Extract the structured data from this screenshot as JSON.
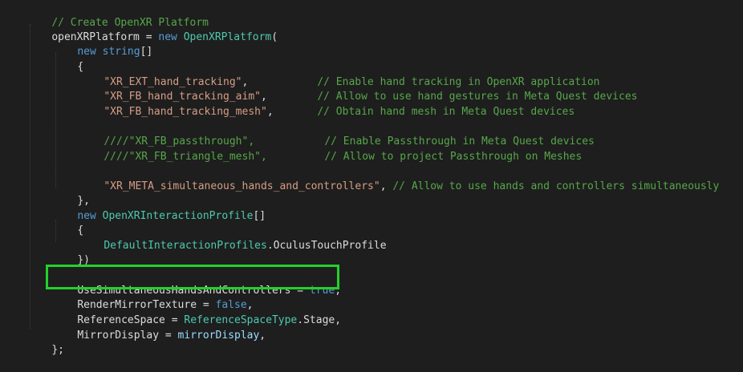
{
  "highlight_color": "#22d12a",
  "editor_background": "#1e1e1e",
  "lines": {
    "l1": {
      "comment": "// Create OpenXR Platform"
    },
    "l2": {
      "var": "openXRPlatform",
      "eq": " = ",
      "kw": "new",
      "type": "OpenXRPlatform",
      "paren": "("
    },
    "l3": {
      "kw": "new",
      "kw2": "string",
      "br": "[]"
    },
    "l4": {
      "brace": "{"
    },
    "l5": {
      "str": "\"XR_EXT_hand_tracking\"",
      "sep": ",",
      "comment": "// Enable hand tracking in OpenXR application"
    },
    "l6": {
      "str": "\"XR_FB_hand_tracking_aim\"",
      "sep": ",",
      "comment": "// Allow to use hand gestures in Meta Quest devices"
    },
    "l7": {
      "str": "\"XR_FB_hand_tracking_mesh\"",
      "sep": ",",
      "comment": "// Obtain hand mesh in Meta Quest devices"
    },
    "l8": {
      "comment": "////\"XR_FB_passthrough\",",
      "comment2": "// Enable Passthrough in Meta Quest devices"
    },
    "l9": {
      "comment": "////\"XR_FB_triangle_mesh\",",
      "comment2": "// Allow to project Passthrough on Meshes"
    },
    "l10": {
      "str": "\"XR_META_simultaneous_hands_and_controllers\"",
      "sep": ", ",
      "comment": "// Allow to use hands and controllers simultaneously"
    },
    "l11": {
      "text": "},"
    },
    "l12": {
      "kw": "new",
      "type": "OpenXRInteractionProfile",
      "br": "[]"
    },
    "l13": {
      "brace": "{"
    },
    "l14": {
      "type": "DefaultInteractionProfiles",
      "dot": ".",
      "prop": "OculusTouchProfile"
    },
    "l15": {
      "text": "})"
    },
    "l16": {
      "brace": "{"
    },
    "l17": {
      "prop": "UseSimultaneousHandsAndControllers",
      "eq": " = ",
      "kw": "true",
      "sep": ","
    },
    "l18": {
      "prop": "RenderMirrorTexture",
      "eq": " = ",
      "kw": "false",
      "sep": ","
    },
    "l19": {
      "prop": "ReferenceSpace",
      "eq": " = ",
      "type": "ReferenceSpaceType",
      "dot": ".",
      "prop2": "Stage",
      "sep": ","
    },
    "l20": {
      "prop": "MirrorDisplay",
      "eq": " = ",
      "var": "mirrorDisplay",
      "sep": ","
    },
    "l21": {
      "text": "};"
    }
  }
}
